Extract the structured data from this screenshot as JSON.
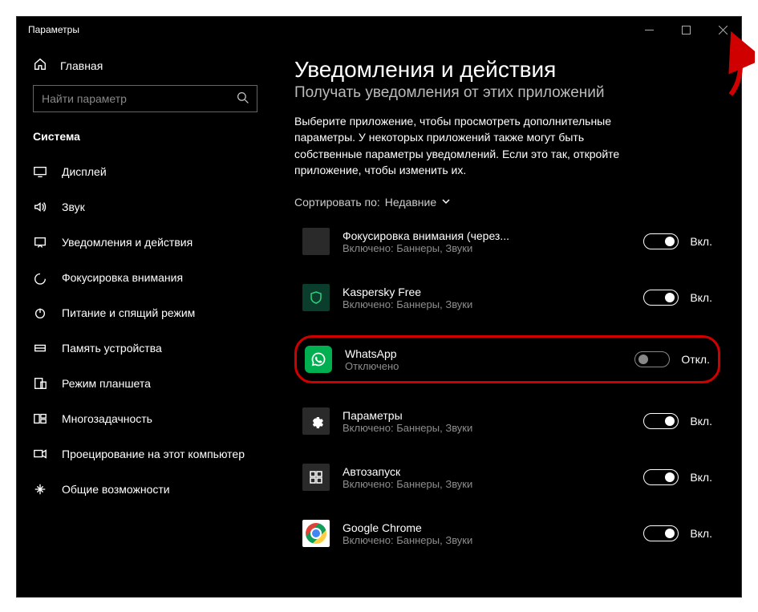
{
  "window": {
    "title": "Параметры"
  },
  "sidebar": {
    "home": "Главная",
    "search_placeholder": "Найти параметр",
    "heading": "Система",
    "items": [
      {
        "label": "Дисплей"
      },
      {
        "label": "Звук"
      },
      {
        "label": "Уведомления и действия"
      },
      {
        "label": "Фокусировка внимания"
      },
      {
        "label": "Питание и спящий режим"
      },
      {
        "label": "Память устройства"
      },
      {
        "label": "Режим планшета"
      },
      {
        "label": "Многозадачность"
      },
      {
        "label": "Проецирование на этот компьютер"
      },
      {
        "label": "Общие возможности"
      }
    ]
  },
  "main": {
    "title": "Уведомления и действия",
    "subtitle": "Получать уведомления от этих приложений",
    "description": "Выберите приложение, чтобы просмотреть дополнительные параметры. У некоторых приложений также могут быть собственные параметры уведомлений. Если это так, откройте приложение, чтобы изменить их.",
    "sort_prefix": "Сортировать по:",
    "sort_value": "Недавние",
    "apps": [
      {
        "name": "Фокусировка внимания (через...",
        "sub": "Включено: Баннеры, Звуки",
        "state_label": "Вкл.",
        "on": true
      },
      {
        "name": "Kaspersky Free",
        "sub": "Включено: Баннеры, Звуки",
        "state_label": "Вкл.",
        "on": true
      },
      {
        "name": "WhatsApp",
        "sub": "Отключено",
        "state_label": "Откл.",
        "on": false
      },
      {
        "name": "Параметры",
        "sub": "Включено: Баннеры, Звуки",
        "state_label": "Вкл.",
        "on": true
      },
      {
        "name": "Автозапуск",
        "sub": "Включено: Баннеры, Звуки",
        "state_label": "Вкл.",
        "on": true
      },
      {
        "name": "Google Chrome",
        "sub": "Включено: Баннеры, Звуки",
        "state_label": "Вкл.",
        "on": true
      }
    ]
  }
}
